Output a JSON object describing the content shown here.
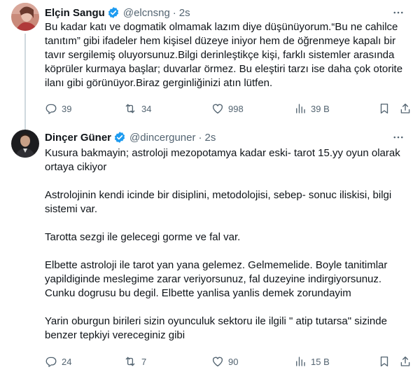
{
  "tweets": [
    {
      "name": "Elçin Sangu",
      "handle": "@elcnsng",
      "separator": "·",
      "time": "2s",
      "avatar_icon": "profile-photo",
      "paragraphs": [
        "Bu kadar katı ve dogmatik olmamak lazım diye düşünüyorum.“Bu ne cahilce tanıtım” gibi ifadeler hem kişisel düzeye iniyor hem de öğrenmeye kapalı bir tavır sergilemiş oluyorsunuz.Bilgi derinleştikçe kişi, farklı sistemler arasında köprüler kurmaya başlar; duvarlar örmez. Bu eleştiri tarzı ise daha çok otorite ilanı gibi görünüyor.Biraz gerginliğinizi atın lütfen."
      ],
      "replies": "39",
      "retweets": "34",
      "likes": "998",
      "views": "39 B"
    },
    {
      "name": "Dinçer Güner",
      "handle": "@dincerguner",
      "separator": "·",
      "time": "2s",
      "avatar_icon": "profile-photo",
      "paragraphs": [
        "Kusura bakmayin; astroloji mezopotamya kadar eski- tarot 15.yy oyun olarak ortaya cikiyor",
        "Astrolojinin kendi icinde bir disiplini, metodolojisi, sebep- sonuc iliskisi, bilgi sistemi var.",
        "Tarotta sezgi ile gelecegi gorme ve fal var.",
        "Elbette astroloji ile tarot yan yana gelemez. Gelmemelide. Boyle tanitimlar yapildiginde meslegime zarar veriyorsunuz, fal duzeyine indirgiyorsunuz. Cunku dogrusu bu degil. Elbette yanlisa yanlis demek zorundayim",
        "Yarin oburgun birileri sizin oyunculuk sektoru ile ilgili \" atip tutarsa\" sizinde benzer tepkiyi vereceginiz gibi"
      ],
      "replies": "24",
      "retweets": "7",
      "likes": "90",
      "views": "15 B"
    }
  ],
  "colors": {
    "text": "#0f1419",
    "secondary": "#536471",
    "verified": "#1d9bf0",
    "thread_line": "#cfd9de"
  },
  "icons": [
    "reply-icon",
    "retweet-icon",
    "like-icon",
    "views-icon",
    "bookmark-icon",
    "share-icon",
    "more-icon",
    "verified-badge-icon"
  ]
}
